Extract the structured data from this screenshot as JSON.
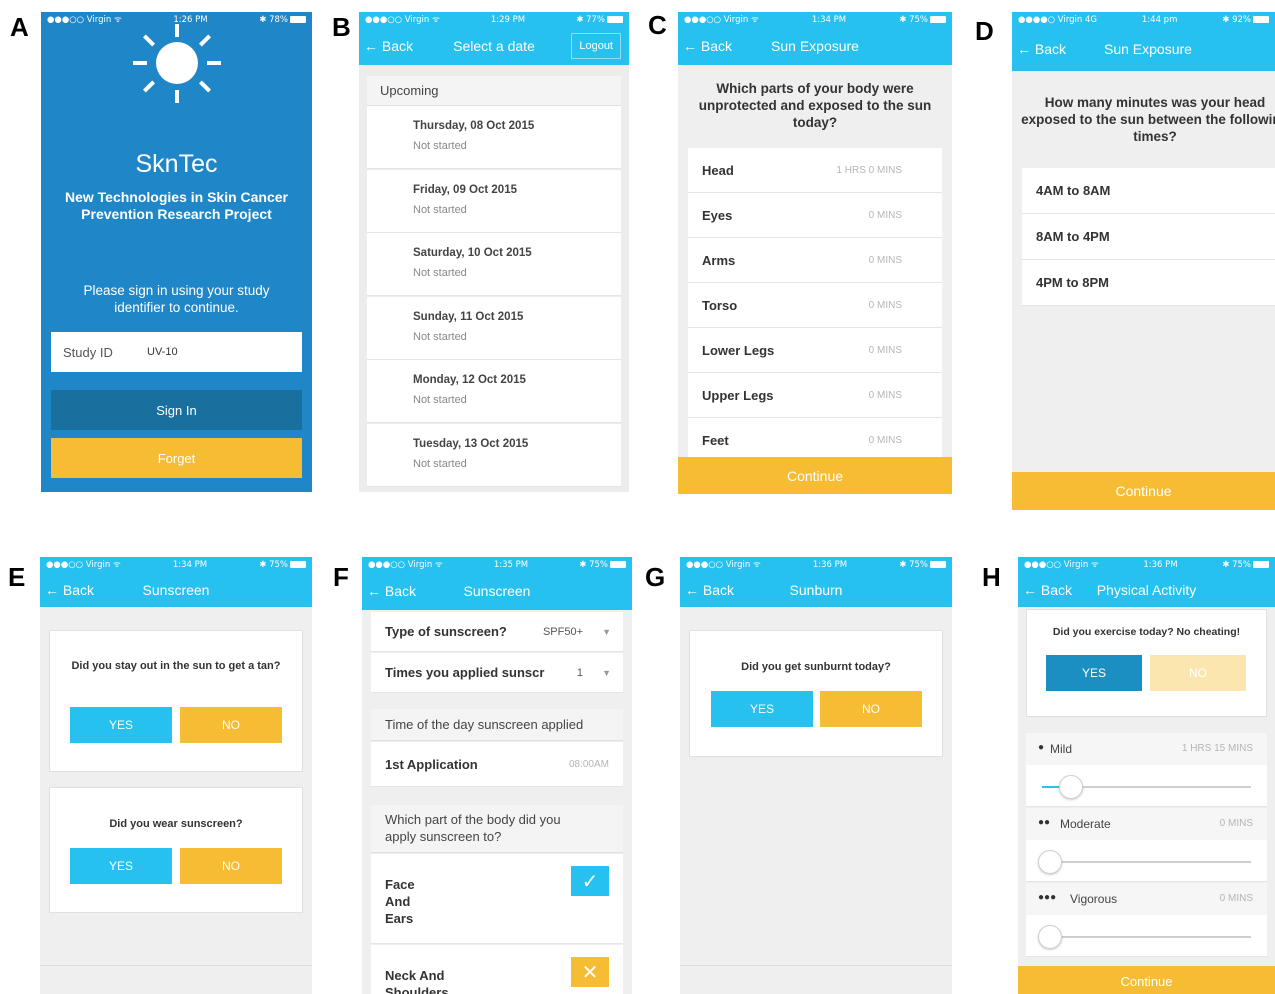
{
  "labels": [
    "A",
    "B",
    "C",
    "D",
    "E",
    "F",
    "G",
    "H"
  ],
  "colors": {
    "nav": "#27c1ef",
    "accent_yellow": "#f6bc33",
    "login_bg": "#1f86c8",
    "signin_dark": "#19709f"
  },
  "screenA": {
    "carrier": "●●●○○ Virgin ᯤ",
    "time": "1:26 PM",
    "battery": "✱ 78%",
    "app_name": "SknTec",
    "subtitle": "New Technologies in Skin Cancer Prevention Research Project",
    "prompt": "Please sign in using your study identifier to continue.",
    "study_id_label": "Study ID",
    "study_id_value": "UV-10",
    "sign_in": "Sign In",
    "forget": "Forget"
  },
  "screenB": {
    "carrier": "●●●○○ Virgin ᯤ",
    "time": "1:29 PM",
    "battery": "✱ 77%",
    "back": "← Back",
    "title": "Select a date",
    "logout": "Logout",
    "section": "Upcoming",
    "dates": [
      {
        "date": "Thursday, 08 Oct 2015",
        "status": "Not started"
      },
      {
        "date": "Friday, 09 Oct 2015",
        "status": "Not started"
      },
      {
        "date": "Saturday, 10 Oct 2015",
        "status": "Not started"
      },
      {
        "date": "Sunday, 11 Oct 2015",
        "status": "Not started"
      },
      {
        "date": "Monday, 12 Oct 2015",
        "status": "Not started"
      },
      {
        "date": "Tuesday, 13 Oct 2015",
        "status": "Not started"
      }
    ]
  },
  "screenC": {
    "carrier": "●●●○○ Virgin ᯤ",
    "time": "1:34 PM",
    "battery": "✱ 75%",
    "back": "← Back",
    "title": "Sun Exposure",
    "question": "Which parts of your body were unprotected and exposed to the sun today?",
    "parts": [
      {
        "label": "Head",
        "value": "1 HRS 0 MINS"
      },
      {
        "label": "Eyes",
        "value": "0 MINS"
      },
      {
        "label": "Arms",
        "value": "0 MINS"
      },
      {
        "label": "Torso",
        "value": "0 MINS"
      },
      {
        "label": "Lower Legs",
        "value": "0 MINS"
      },
      {
        "label": "Upper Legs",
        "value": "0 MINS"
      },
      {
        "label": "Feet",
        "value": "0 MINS"
      }
    ],
    "continue": "Continue"
  },
  "screenD": {
    "carrier": "●●●●○ Virgin 4G",
    "time": "1:44 pm",
    "battery": "✱ 92%",
    "back": "← Back",
    "title": "Sun Exposure",
    "question": "How many minutes was your head exposed to the sun between the following times?",
    "ranges": [
      "4AM to 8AM",
      "8AM to 4PM",
      "4PM to 8PM"
    ],
    "continue": "Continue"
  },
  "screenE": {
    "carrier": "●●●○○ Virgin ᯤ",
    "time": "1:34 PM",
    "battery": "✱ 75%",
    "back": "← Back",
    "title": "Sunscreen",
    "q1": "Did you stay out in the sun to get a tan?",
    "q2": "Did you wear sunscreen?",
    "yes": "YES",
    "no": "NO"
  },
  "screenF": {
    "carrier": "●●●○○ Virgin ᯤ",
    "time": "1:35 PM",
    "battery": "✱ 75%",
    "back": "← Back",
    "title": "Sunscreen",
    "type_label": "Type of sunscreen?",
    "type_value": "SPF50+",
    "times_label": "Times you applied sunscr",
    "times_value": "1",
    "time_header": "Time of the day sunscreen applied",
    "app_label": "1st Application",
    "app_value": "08:00AM",
    "body_header": "Which part of the body did you apply sunscreen to?",
    "part1": "Face And Ears",
    "part2": "Neck And Shoulders",
    "check": "✓",
    "cross": "✕"
  },
  "screenG": {
    "carrier": "●●●○○ Virgin ᯤ",
    "time": "1:36 PM",
    "battery": "✱ 75%",
    "back": "← Back",
    "title": "Sunburn",
    "question": "Did you get sunburnt today?",
    "yes": "YES",
    "no": "NO"
  },
  "screenH": {
    "carrier": "●●●○○ Virgin ᯤ",
    "time": "1:36 PM",
    "battery": "✱ 75%",
    "back": "← Back",
    "title": "Physical Activity",
    "question": "Did you exercise today? No cheating!",
    "yes": "YES",
    "no": "NO",
    "levels": [
      {
        "icon": "💧",
        "label": "Mild",
        "value": "1 HRS 15 MINS",
        "level": 0.1
      },
      {
        "icon": "💧💧",
        "label": "Moderate",
        "value": "0 MINS",
        "level": 0
      },
      {
        "icon": "💧💧💧",
        "label": "Vigorous",
        "value": "0 MINS",
        "level": 0
      }
    ],
    "continue": "Continue"
  }
}
